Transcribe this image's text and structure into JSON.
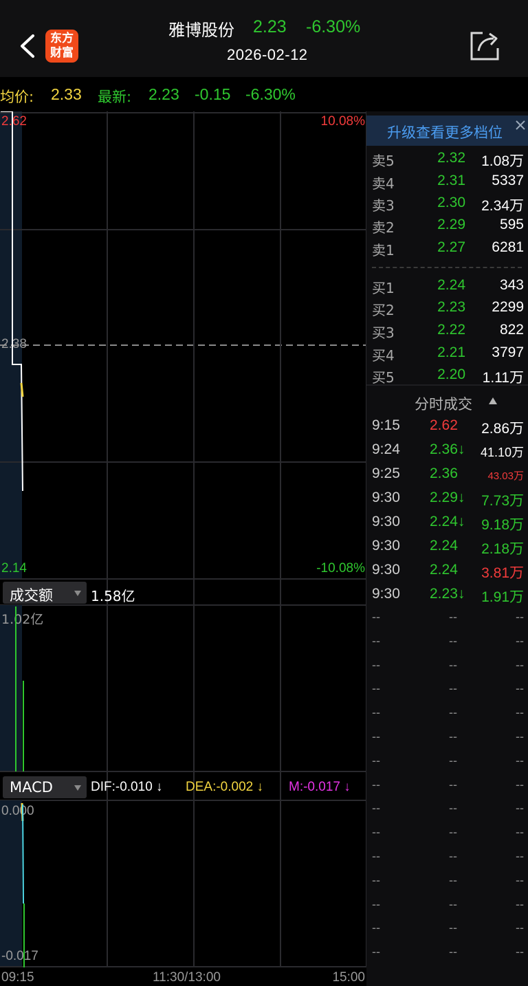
{
  "header": {
    "logo_line1": "东方",
    "logo_line2": "财富",
    "stock_name": "雅博股份",
    "price": "2.23",
    "change_pct": "-6.30%",
    "date": "2026-02-12"
  },
  "info_bar": {
    "avg_label": "均价:",
    "avg_value": "2.33",
    "latest_label": "最新:",
    "latest_value": "2.23",
    "change": "-0.15",
    "change_pct": "-6.30%"
  },
  "price_chart": {
    "high_label": "2.62",
    "mid_label": "2.38",
    "low_label": "2.14",
    "high_pct": "10.08%",
    "low_pct": "-10.08%"
  },
  "volume_panel": {
    "selector_label": "成交额",
    "total": "1.58亿",
    "max_label": "1.02亿"
  },
  "macd_panel": {
    "selector_label": "MACD",
    "dif": "DIF:-0.010 ↓",
    "dea": "DEA:-0.002 ↓",
    "m": "M:-0.017 ↓",
    "top_label": "0.000",
    "bottom_label": "-0.017"
  },
  "time_axis": {
    "start": "09:15",
    "mid": "11:30/13:00",
    "end": "15:00"
  },
  "order_book": {
    "upgrade_text": "升级查看更多档位",
    "asks": [
      {
        "label": "卖5",
        "price": "2.32",
        "volume": "1.08万"
      },
      {
        "label": "卖4",
        "price": "2.31",
        "volume": "5337"
      },
      {
        "label": "卖3",
        "price": "2.30",
        "volume": "2.34万"
      },
      {
        "label": "卖2",
        "price": "2.29",
        "volume": "595"
      },
      {
        "label": "卖1",
        "price": "2.27",
        "volume": "6281"
      }
    ],
    "bids": [
      {
        "label": "买1",
        "price": "2.24",
        "volume": "343"
      },
      {
        "label": "买2",
        "price": "2.23",
        "volume": "2299"
      },
      {
        "label": "买3",
        "price": "2.22",
        "volume": "822"
      },
      {
        "label": "买4",
        "price": "2.21",
        "volume": "3797"
      },
      {
        "label": "买5",
        "price": "2.20",
        "volume": "1.11万"
      }
    ]
  },
  "ticks": {
    "header": "分时成交",
    "rows": [
      {
        "time": "9:15",
        "price": "2.62",
        "volume": "2.86万"
      },
      {
        "time": "9:24",
        "price": "2.36↓",
        "volume": "41.10万"
      },
      {
        "time": "9:25",
        "price": "2.36",
        "volume": "43.03万"
      },
      {
        "time": "9:30",
        "price": "2.29↓",
        "volume": "7.73万"
      },
      {
        "time": "9:30",
        "price": "2.24↓",
        "volume": "9.18万"
      },
      {
        "time": "9:30",
        "price": "2.24",
        "volume": "2.18万"
      },
      {
        "time": "9:30",
        "price": "2.24",
        "volume": "3.81万"
      },
      {
        "time": "9:30",
        "price": "2.23↓",
        "volume": "1.91万"
      }
    ],
    "empty_cell": "--"
  },
  "colors": {
    "up": "#f23b3b",
    "down": "#2fc72f",
    "avg": "#f4d641",
    "accent": "#4b9cf0",
    "brand": "#f04a1b"
  }
}
